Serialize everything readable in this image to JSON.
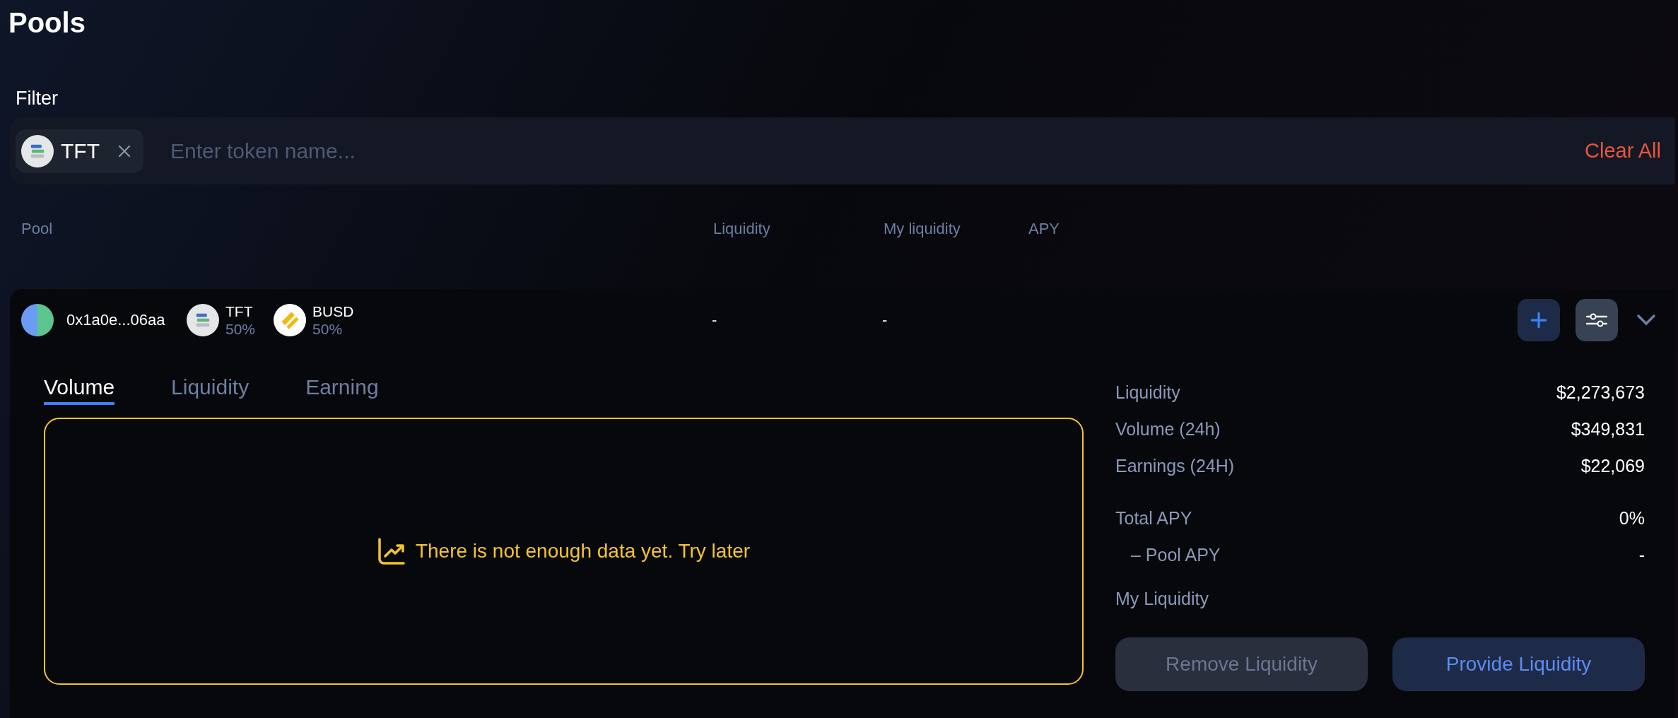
{
  "page": {
    "title": "Pools"
  },
  "filter": {
    "label": "Filter",
    "chips": [
      {
        "symbol": "TFT",
        "kind": "tft"
      }
    ],
    "placeholder": "Enter token name...",
    "clear_button": "Clear All"
  },
  "table": {
    "columns": [
      "Pool",
      "Liquidity",
      "My liquidity",
      "APY"
    ],
    "rows": [
      {
        "address": "0x1a0e...06aa",
        "tokens": [
          {
            "symbol": "TFT",
            "share": "50%",
            "kind": "tft"
          },
          {
            "symbol": "BUSD",
            "share": "50%",
            "kind": "busd"
          }
        ],
        "liquidity": "-",
        "my_liquidity": "-",
        "expanded": true,
        "details": {
          "tabs": [
            {
              "label": "Volume",
              "selected": true
            },
            {
              "label": "Liquidity",
              "selected": false
            },
            {
              "label": "Earning",
              "selected": false
            }
          ],
          "chart_message": "There is not enough data yet. Try later",
          "stat_groups": [
            [
              {
                "label": "Liquidity",
                "value": "$2,273,673",
                "kind": "main"
              },
              {
                "label": "Volume (24h)",
                "value": "$349,831",
                "kind": "main"
              },
              {
                "label": "Earnings (24H)",
                "value": "$22,069",
                "kind": "main"
              }
            ],
            [
              {
                "label": "Total APY",
                "value": "0%",
                "kind": "main"
              },
              {
                "label": "– Pool APY",
                "value": "-",
                "kind": "sub"
              }
            ]
          ],
          "my_liquidity_label": "My Liquidity",
          "buttons": [
            {
              "label": "Remove Liquidity",
              "disabled": true
            },
            {
              "label": "Provide Liquidity",
              "disabled": false
            }
          ]
        }
      }
    ]
  }
}
